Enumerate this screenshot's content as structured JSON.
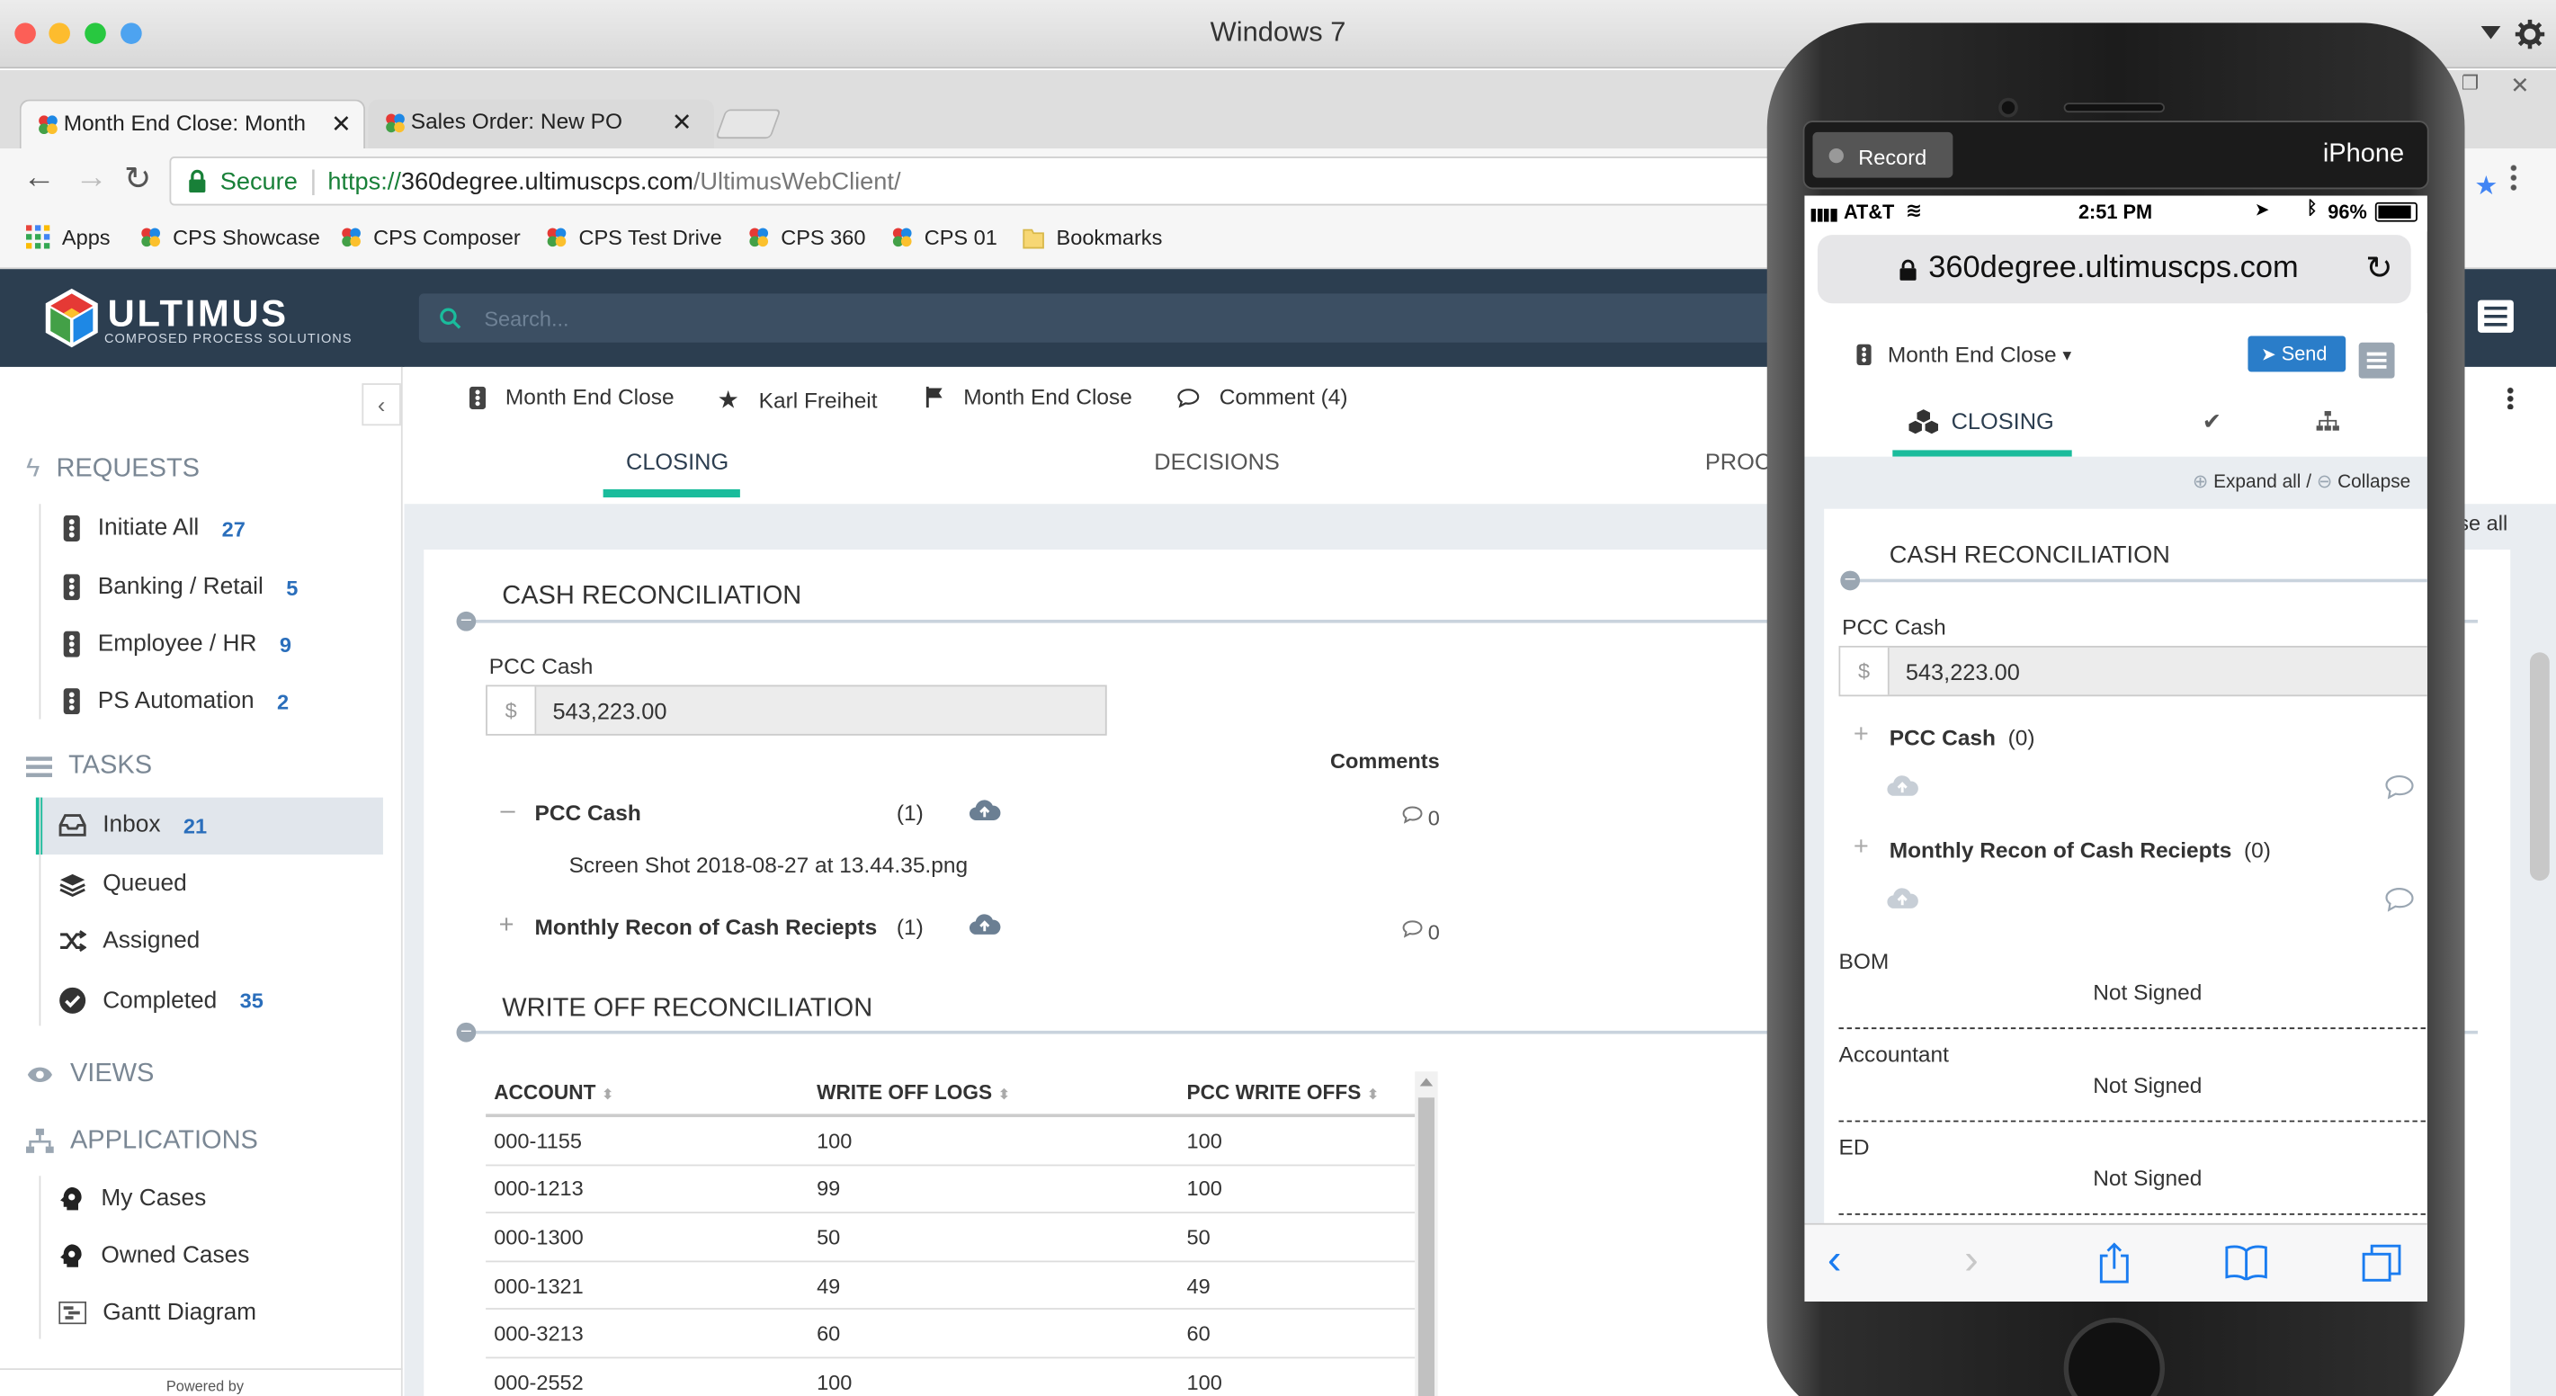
{
  "window": {
    "title": "Windows 7"
  },
  "tabs": [
    {
      "label": "Month End Close: Month"
    },
    {
      "label": "Sales Order: New PO"
    }
  ],
  "address": {
    "secure_label": "Secure",
    "url_scheme": "https://",
    "url_host": "360degree.ultimuscps.com",
    "url_path": "/UltimusWebClient/"
  },
  "bookmarks": [
    "Apps",
    "CPS Showcase",
    "CPS Composer",
    "CPS Test Drive",
    "CPS 360",
    "CPS 01",
    "Bookmarks"
  ],
  "app": {
    "logo_name": "ULTIMUS",
    "logo_tagline": "COMPOSED PROCESS SOLUTIONS",
    "search_placeholder": "Search..."
  },
  "sidebar": {
    "requests_title": "REQUESTS",
    "requests": [
      {
        "label": "Initiate All",
        "count": "27"
      },
      {
        "label": "Banking / Retail",
        "count": "5"
      },
      {
        "label": "Employee / HR",
        "count": "9"
      },
      {
        "label": "PS Automation",
        "count": "2"
      }
    ],
    "tasks_title": "TASKS",
    "tasks": [
      {
        "label": "Inbox",
        "count": "21"
      },
      {
        "label": "Queued",
        "count": ""
      },
      {
        "label": "Assigned",
        "count": ""
      },
      {
        "label": "Completed",
        "count": "35"
      }
    ],
    "views_title": "VIEWS",
    "applications_title": "APPLICATIONS",
    "applications": [
      "My Cases",
      "Owned Cases",
      "Gantt Diagram"
    ],
    "powered_by": "Powered by"
  },
  "form_header": {
    "process": "Month End Close",
    "user": "Karl Freiheit",
    "step": "Month End Close",
    "comment": "Comment (4)",
    "tabs": [
      "CLOSING",
      "DECISIONS",
      "PROC"
    ],
    "active_tab": "CLOSING",
    "collapse_all_fragment": "se all"
  },
  "cash_recon": {
    "title": "CASH RECONCILIATION",
    "pcc_label": "PCC Cash",
    "currency": "$",
    "pcc_value": "543,223.00",
    "comments_header": "Comments",
    "attachments": [
      {
        "name": "PCC Cash",
        "count": "(1)",
        "comments": "0",
        "expanded": true,
        "file": "Screen Shot 2018-08-27 at 13.44.35.png"
      },
      {
        "name": "Monthly Recon of Cash Reciepts",
        "count": "(1)",
        "comments": "0",
        "expanded": false,
        "file": ""
      }
    ]
  },
  "write_off": {
    "title": "WRITE OFF RECONCILIATION",
    "columns": [
      "ACCOUNT",
      "WRITE OFF LOGS",
      "PCC WRITE OFFS"
    ],
    "rows": [
      [
        "000-1155",
        "100",
        "100"
      ],
      [
        "000-1213",
        "99",
        "100"
      ],
      [
        "000-1300",
        "50",
        "50"
      ],
      [
        "000-1321",
        "49",
        "49"
      ],
      [
        "000-3213",
        "60",
        "60"
      ],
      [
        "000-2552",
        "100",
        "100"
      ]
    ]
  },
  "phone": {
    "record_label": "Record",
    "device_label": "iPhone",
    "status": {
      "carrier": "AT&T",
      "time": "2:51 PM",
      "battery": "96%"
    },
    "url": "360degree.ultimuscps.com",
    "process_menu": "Month End Close",
    "send_label": "Send",
    "tab_label": "CLOSING",
    "expand_all": "Expand all /",
    "collapse": "Collapse",
    "section_title": "CASH RECONCILIATION",
    "pcc_label": "PCC Cash",
    "currency": "$",
    "pcc_value": "543,223.00",
    "attachments": [
      {
        "name": "PCC Cash",
        "count": "(0)"
      },
      {
        "name": "Monthly Recon of Cash Reciepts",
        "count": "(0)"
      }
    ],
    "signatures": [
      {
        "role": "BOM",
        "status": "Not Signed"
      },
      {
        "role": "Accountant",
        "status": "Not Signed"
      },
      {
        "role": "ED",
        "status": "Not Signed"
      }
    ]
  }
}
